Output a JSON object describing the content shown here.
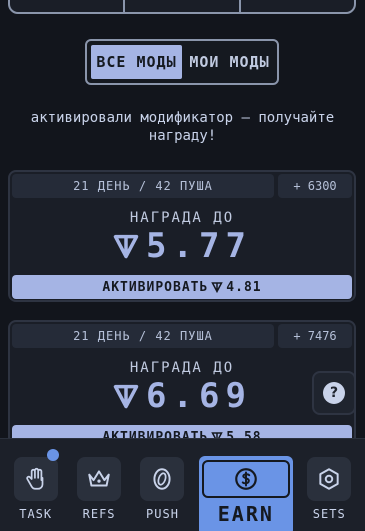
{
  "toggle": {
    "all_mods": "все моды",
    "my_mods": "мои моды",
    "selected": "all_mods"
  },
  "notice": "активировали модификатор — получайте награду!",
  "cards": [
    {
      "days": "21 день / 42 пуша",
      "bonus": "+ 6300",
      "reward_label": "награда до",
      "reward_value": "5.77",
      "activate_label": "активировать",
      "activate_value": "4.81"
    },
    {
      "days": "21 день / 42 пуша",
      "bonus": "+ 7476",
      "reward_label": "награда до",
      "reward_value": "6.69",
      "activate_label": "активировать",
      "activate_value": "5.58"
    }
  ],
  "help": "?",
  "nav": [
    {
      "label": "TASK",
      "icon": "hand-icon",
      "active": false,
      "has_dot": true
    },
    {
      "label": "REFS",
      "icon": "crown-icon",
      "active": false
    },
    {
      "label": "PUSH",
      "icon": "coin-icon",
      "active": false
    },
    {
      "label": "EARN",
      "icon": "dollar-circle-icon",
      "active": true
    },
    {
      "label": "SETS",
      "icon": "settings-hex-icon",
      "active": false
    }
  ],
  "colors": {
    "background": "#12151c",
    "accent": "#a5b4e4",
    "active_nav": "#6a94e6",
    "card": "#1a1e27"
  }
}
